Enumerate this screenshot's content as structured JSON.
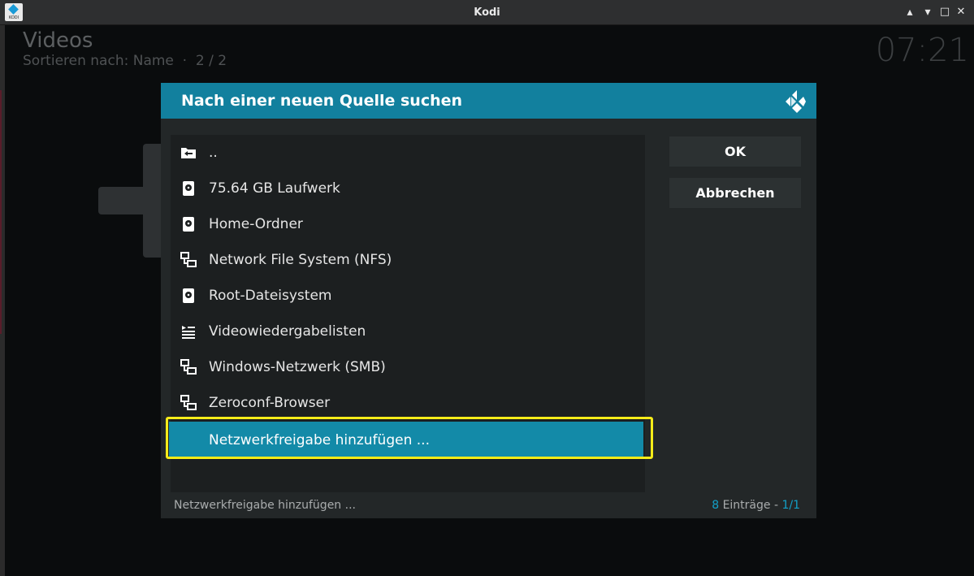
{
  "window": {
    "title": "Kodi",
    "app_icon_text": "KODI",
    "minimize": "▴",
    "restore": "▾",
    "maximize": "□",
    "close": "✕"
  },
  "background": {
    "section_title": "Videos",
    "sort_info": "Sortieren nach: Name  ·  2 / 2",
    "clock": "07:21"
  },
  "dialog": {
    "title": "Nach einer neuen Quelle suchen",
    "items": [
      {
        "label": "..",
        "icon": "folder-back-icon"
      },
      {
        "label": "75.64 GB Laufwerk",
        "icon": "hard-drive-icon"
      },
      {
        "label": "Home-Ordner",
        "icon": "hard-drive-icon"
      },
      {
        "label": "Network File System (NFS)",
        "icon": "network-icon"
      },
      {
        "label": "Root-Dateisystem",
        "icon": "hard-drive-icon"
      },
      {
        "label": "Videowiedergabelisten",
        "icon": "playlist-icon"
      },
      {
        "label": "Windows-Netzwerk (SMB)",
        "icon": "network-icon"
      },
      {
        "label": "Zeroconf-Browser",
        "icon": "network-icon"
      },
      {
        "label": "Netzwerkfreigabe hinzufügen ...",
        "icon": "",
        "selected": true
      }
    ],
    "ok_label": "OK",
    "cancel_label": "Abbrechen",
    "footer": {
      "selected_label": "Netzwerkfreigabe hinzufügen ...",
      "count": "8",
      "entries_label": " Einträge - ",
      "page": "1/1"
    }
  },
  "colors": {
    "accent": "#12809e",
    "selected": "#138aa8",
    "highlight": "#f6ec19"
  }
}
